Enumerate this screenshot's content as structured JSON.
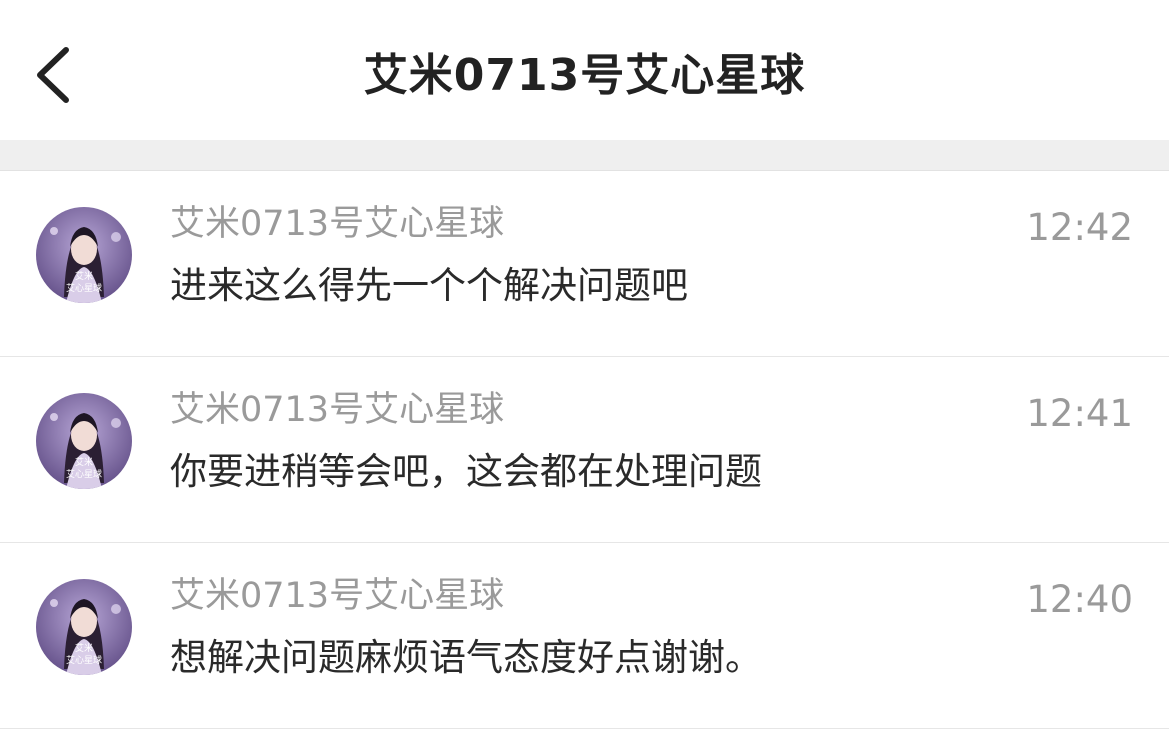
{
  "header": {
    "title": "艾米0713号艾心星球"
  },
  "avatar_text": "艾米\n艾心星球",
  "messages": [
    {
      "sender": "艾米0713号艾心星球",
      "text": "进来这么得先一个个解决问题吧",
      "time": "12:42"
    },
    {
      "sender": "艾米0713号艾心星球",
      "text": "你要进稍等会吧，这会都在处理问题",
      "time": "12:41"
    },
    {
      "sender": "艾米0713号艾心星球",
      "text": "想解决问题麻烦语气态度好点谢谢。",
      "time": "12:40"
    }
  ],
  "colors": {
    "title": "#222222",
    "secondary_text": "#9a9a9a",
    "primary_text": "#2a2a2a",
    "band": "#efefef",
    "avatar_bg": "#6e5a94"
  }
}
